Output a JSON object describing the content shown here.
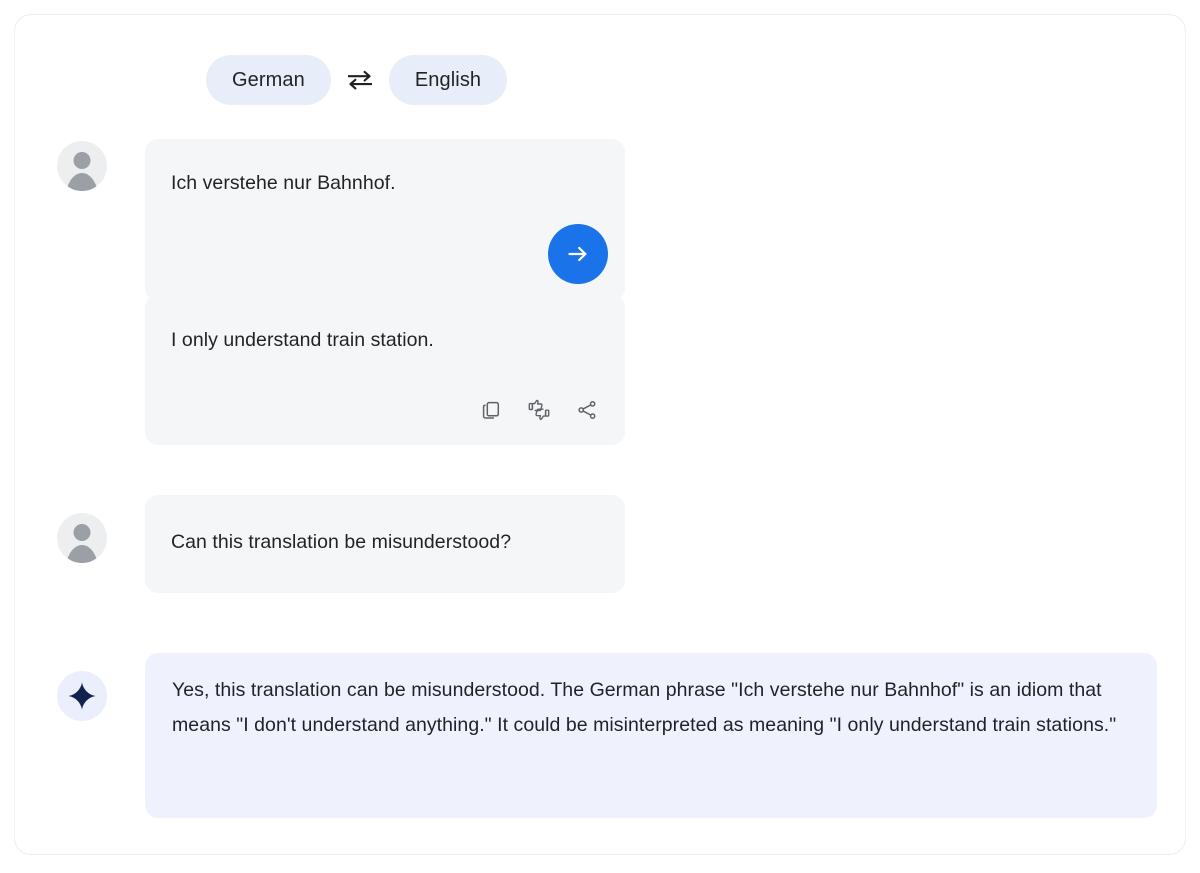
{
  "app": {
    "title": "Translation chat",
    "accent_color": "#1a73e8",
    "chip_color": "#e7edf9",
    "user_bubble_color": "#f5f6f8",
    "ai_bubble_color": "#eff2fd",
    "text_color": "#1f2326"
  },
  "language_bar": {
    "source_language": "German",
    "target_language": "English",
    "swap_icon": "swap-horizontal-icon",
    "swap_label": "Swap languages"
  },
  "conversation": [
    {
      "role": "user",
      "avatar_icon": "user-avatar-icon",
      "text": "Ich verstehe nur Bahnhof.",
      "send_button": {
        "icon": "arrow-right-icon",
        "label": "Translate"
      }
    },
    {
      "role": "assistant",
      "text": "I only understand train station.",
      "actions": [
        {
          "icon": "copy-icon",
          "label": "Copy"
        },
        {
          "icon": "thumbs-up-down-icon",
          "label": "Rate this translation"
        },
        {
          "icon": "share-icon",
          "label": "Share"
        }
      ]
    },
    {
      "role": "user",
      "avatar_icon": "user-avatar-icon",
      "text": "Can this translation be misunderstood?"
    },
    {
      "role": "assistant",
      "avatar_icon": "gemini-sparkle-icon",
      "text": "Yes, this translation can be misunderstood. The German phrase \"Ich verstehe nur Bahnhof\" is an idiom that means \"I don't understand anything.\" It could be misinterpreted as meaning \"I only understand train stations.\""
    }
  ]
}
